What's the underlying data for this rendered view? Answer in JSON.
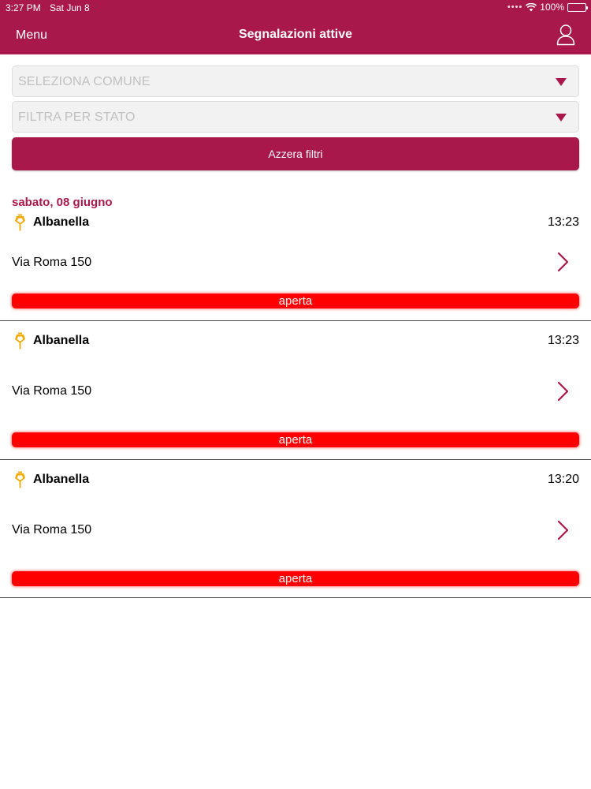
{
  "status_bar": {
    "time": "3:27 PM",
    "date": "Sat Jun 8",
    "battery": "100%"
  },
  "header": {
    "menu_label": "Menu",
    "title": "Segnalazioni attive",
    "profile_icon": "user-icon"
  },
  "filters": {
    "comune_placeholder": "SELEZIONA COMUNE",
    "stato_placeholder": "FILTRA PER STATO",
    "reset_label": "Azzera filtri"
  },
  "date_header": "sabato, 08 giugno",
  "reports": [
    {
      "town": "Albanella",
      "time": "13:23",
      "address": "Via Roma 150",
      "status": "aperta",
      "icon": "street-lamp-icon"
    },
    {
      "town": "Albanella",
      "time": "13:23",
      "address": "Via Roma 150",
      "status": "aperta",
      "icon": "street-lamp-icon"
    },
    {
      "town": "Albanella",
      "time": "13:20",
      "address": "Via Roma 150",
      "status": "aperta",
      "icon": "street-lamp-icon"
    }
  ],
  "colors": {
    "brand": "#a8184a",
    "status_open": "#ff0000",
    "lamp": "#f2a900"
  }
}
